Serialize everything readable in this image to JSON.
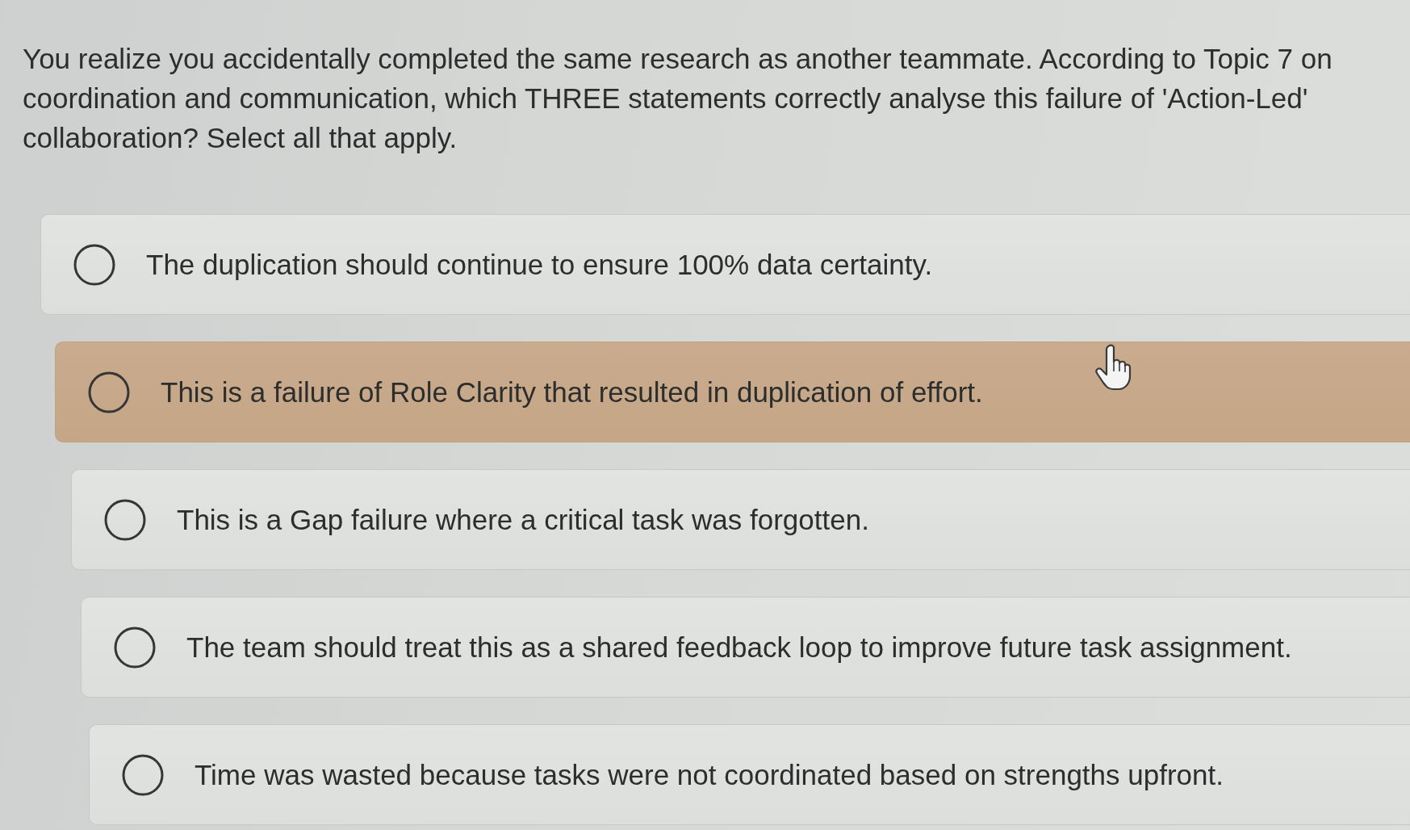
{
  "question": {
    "text": "You realize you accidentally completed the same research as another teammate. According to Topic 7 on coordination and communication, which THREE statements correctly analyse this failure of 'Action-Led' collaboration? Select all that apply."
  },
  "options": [
    {
      "label": "The duplication should continue to ensure 100% data certainty.",
      "selected": false,
      "highlighted": false
    },
    {
      "label": "This is a failure of Role Clarity that resulted in duplication of effort.",
      "selected": false,
      "highlighted": true
    },
    {
      "label": "This is a Gap failure where a critical task was forgotten.",
      "selected": false,
      "highlighted": false
    },
    {
      "label": "The team should treat this as a shared feedback loop to improve future task assignment.",
      "selected": false,
      "highlighted": false
    },
    {
      "label": "Time was wasted because tasks were not coordinated based on strengths upfront.",
      "selected": false,
      "highlighted": false
    }
  ]
}
